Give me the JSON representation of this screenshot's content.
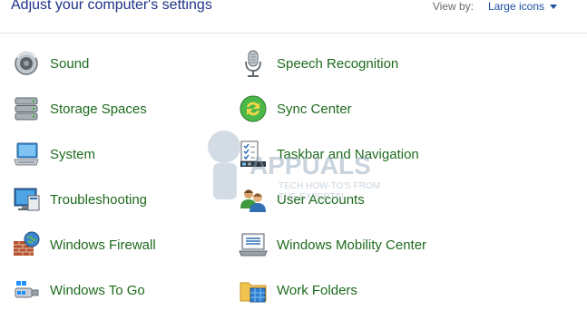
{
  "header": {
    "title": "Adjust your computer's settings",
    "view_by_label": "View by:",
    "view_by_value": "Large icons"
  },
  "items": [
    {
      "label": "Sound",
      "icon": "speaker-icon"
    },
    {
      "label": "Storage Spaces",
      "icon": "storage-drives-icon"
    },
    {
      "label": "System",
      "icon": "computer-icon"
    },
    {
      "label": "Troubleshooting",
      "icon": "troubleshoot-monitor-icon"
    },
    {
      "label": "Windows Firewall",
      "icon": "brick-wall-globe-icon"
    },
    {
      "label": "Windows To Go",
      "icon": "usb-drive-icon"
    },
    {
      "label": "Speech Recognition",
      "icon": "microphone-icon"
    },
    {
      "label": "Sync Center",
      "icon": "sync-arrows-icon"
    },
    {
      "label": "Taskbar and Navigation",
      "icon": "taskbar-checklist-icon"
    },
    {
      "label": "User Accounts",
      "icon": "users-icon"
    },
    {
      "label": "Windows Mobility Center",
      "icon": "mobility-laptop-icon"
    },
    {
      "label": "Work Folders",
      "icon": "folder-icon"
    }
  ],
  "watermark": {
    "brand": "APPUALS",
    "tagline_1": "TECH HOW-TO'S FROM",
    "tagline_2": "THE EXPERTS!"
  },
  "colors": {
    "title": "#1e3287",
    "link_green": "#1e6b1e",
    "dropdown_blue": "#1f4fa3"
  }
}
